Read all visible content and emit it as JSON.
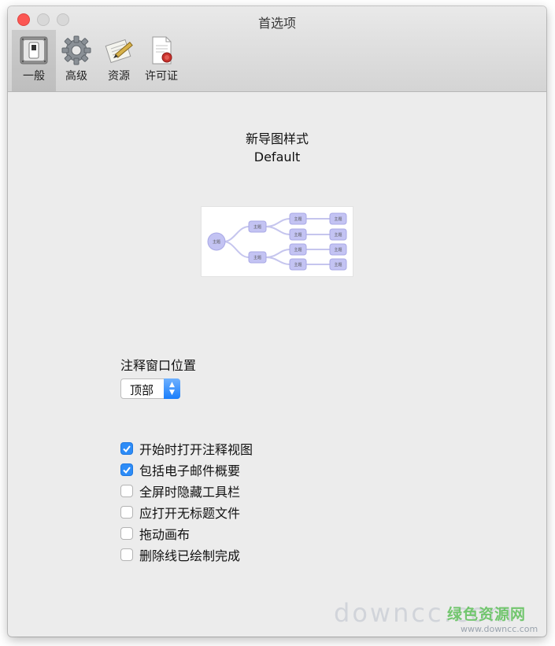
{
  "window": {
    "title": "首选项"
  },
  "toolbar": {
    "items": [
      {
        "label": "一般",
        "icon": "switch-icon",
        "selected": true
      },
      {
        "label": "高级",
        "icon": "gear-icon",
        "selected": false
      },
      {
        "label": "资源",
        "icon": "pencil-paper-icon",
        "selected": false
      },
      {
        "label": "许可证",
        "icon": "certificate-icon",
        "selected": false
      }
    ]
  },
  "map_style": {
    "heading": "新导图样式",
    "value": "Default",
    "preview_nodes": {
      "central": "主题",
      "topic": "主题",
      "subtopic": "主题"
    }
  },
  "note_window": {
    "heading": "注释窗口位置",
    "selected": "顶部"
  },
  "checkboxes": [
    {
      "label": "开始时打开注释视图",
      "checked": true
    },
    {
      "label": "包括电子邮件概要",
      "checked": true
    },
    {
      "label": "全屏时隐藏工具栏",
      "checked": false
    },
    {
      "label": "应打开无标题文件",
      "checked": false
    },
    {
      "label": "拖动画布",
      "checked": false
    },
    {
      "label": "删除线已绘制完成",
      "checked": false
    }
  ],
  "watermark": {
    "site_name": "绿色资源网",
    "url": "www.downcc.com",
    "big_text": "downcc.com"
  },
  "colors": {
    "accent": "#2d8cf7",
    "close": "#fc5753",
    "node_fill": "#c3c3f3"
  }
}
